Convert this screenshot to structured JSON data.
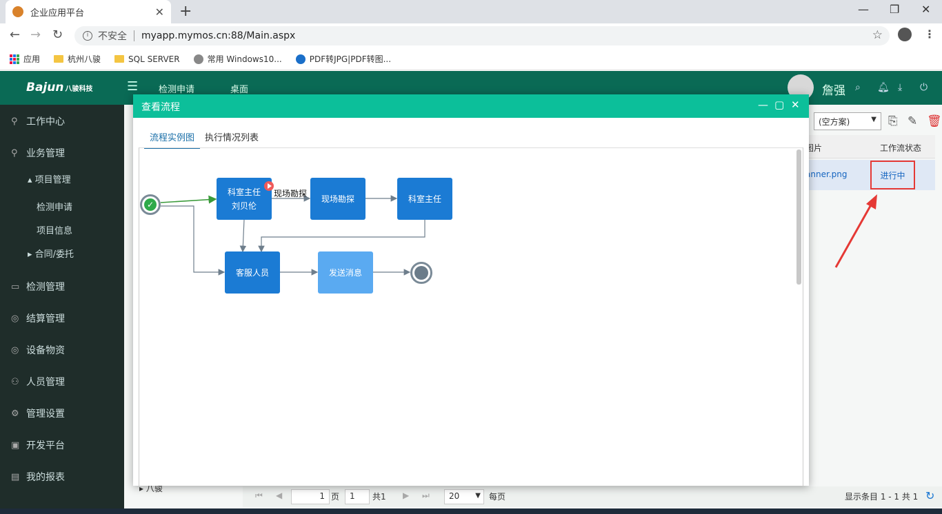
{
  "browser": {
    "tab_title": "企业应用平台",
    "address_security": "不安全",
    "url": "myapp.mymos.cn:88/Main.aspx",
    "bookmarks": [
      "应用",
      "杭州八骏",
      "SQL SERVER",
      "常用 Windows10...",
      "PDF转JPG|PDF转图..."
    ]
  },
  "header": {
    "logo": "Bajun",
    "logo_sub": "八骏科技",
    "tabs": [
      "检测申请",
      "桌面"
    ],
    "username": "詹强"
  },
  "sidebar": {
    "items": [
      "工作中心",
      "业务管理",
      "检测管理",
      "结算管理",
      "设备物资",
      "人员管理",
      "管理设置",
      "开发平台",
      "我的报表"
    ],
    "sub_project": "项目管理",
    "sub_items": [
      "检测申请",
      "项目信息"
    ],
    "sub_contract": "合同/委托"
  },
  "background": {
    "scheme_select": "(空方案)",
    "col_image": "图片",
    "col_status": "工作流状态",
    "row_image": "anner.png",
    "row_status": "进行中",
    "tree_leaf": "八骏",
    "pager": {
      "page_input": "1",
      "page_label": "页",
      "page_num": "1",
      "total_label": "共1",
      "page_size": "20",
      "per_page": "每页",
      "summary": "显示条目 1 - 1 共 1"
    }
  },
  "dialog": {
    "title": "查看流程",
    "tabs": [
      "流程实例图",
      "执行情况列表"
    ],
    "nodes": {
      "n1_line1": "科室主任",
      "n1_line2": "刘贝伦",
      "n2": "现场勘探",
      "n3": "科室主任",
      "n4": "客服人员",
      "n5": "发送消息"
    },
    "edge_label": "现场勘探"
  },
  "colors": {
    "header_bg": "#0a6a55",
    "sidebar_bg": "#1f2d2a",
    "dialog_title_bg": "#0cbf9a",
    "node_active": "#1b7bd4",
    "node_pending": "#5aaaf1",
    "highlight_red": "#e53935"
  }
}
